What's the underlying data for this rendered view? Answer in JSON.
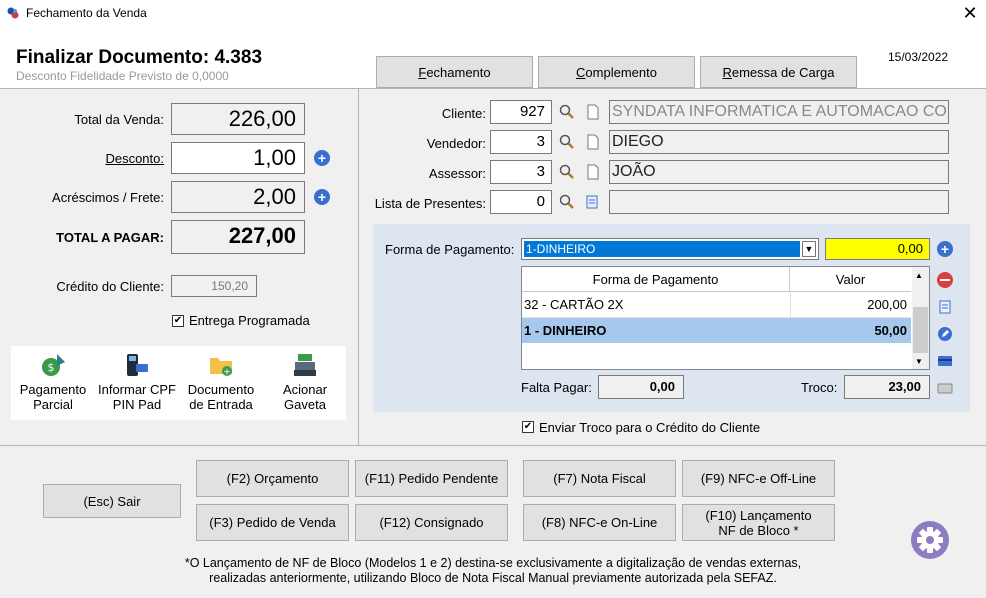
{
  "window": {
    "title": "Fechamento da Venda",
    "close_glyph": "✕"
  },
  "header": {
    "doc_title": "Finalizar Documento: 4.383",
    "doc_subtitle": "Desconto Fidelidade Previsto de 0,0000",
    "date": "15/03/2022",
    "tabs": [
      {
        "label": "Fechamento"
      },
      {
        "label": "Complemento"
      },
      {
        "label": "Remessa de Carga"
      }
    ]
  },
  "totals": {
    "total_label": "Total da Venda:",
    "total_value": "226,00",
    "discount_label": "Desconto:",
    "discount_value": "1,00",
    "surcharge_label": "Acréscimos / Frete:",
    "surcharge_value": "2,00",
    "to_pay_label": "TOTAL A PAGAR:",
    "to_pay_value": "227,00",
    "credit_label": "Crédito do Cliente:",
    "credit_value": "150,20",
    "scheduled_label": "Entrega Programada",
    "scheduled_checked": true
  },
  "tools": [
    {
      "label1": "Pagamento",
      "label2": "Parcial",
      "icon": "money-bag-icon"
    },
    {
      "label1": "Informar CPF",
      "label2": "PIN Pad",
      "icon": "pinpad-icon"
    },
    {
      "label1": "Documento",
      "label2": "de Entrada",
      "icon": "folder-add-icon"
    },
    {
      "label1": "Acionar",
      "label2": "Gaveta",
      "icon": "cash-register-icon"
    }
  ],
  "customer": {
    "cliente_label": "Cliente:",
    "cliente_code": "927",
    "cliente_name": "SYNDATA INFORMATICA E AUTOMACAO COM",
    "vendedor_label": "Vendedor:",
    "vendedor_code": "3",
    "vendedor_name": "DIEGO",
    "assessor_label": "Assessor:",
    "assessor_code": "3",
    "assessor_name": "JOÃO",
    "presentes_label": "Lista de Presentes:",
    "presentes_code": "0",
    "presentes_name": ""
  },
  "payment": {
    "method_label": "Forma de Pagamento:",
    "method_selected": "1-DINHEIRO",
    "method_value": "0,00",
    "grid_headers": {
      "method": "Forma de Pagamento",
      "value": "Valor"
    },
    "rows": [
      {
        "method": "32 - CARTÃO 2X",
        "value": "200,00",
        "selected": false
      },
      {
        "method": "1 - DINHEIRO",
        "value": "50,00",
        "selected": true
      }
    ],
    "falta_label": "Falta Pagar:",
    "falta_value": "0,00",
    "troco_label": "Troco:",
    "troco_value": "23,00",
    "send_change_label": "Enviar Troco para o Crédito do Cliente",
    "send_change_checked": true
  },
  "buttons": {
    "exit": "(Esc) Sair",
    "orcamento": "(F2) Orçamento",
    "pedido_pendente": "(F11) Pedido Pendente",
    "nota_fiscal": "(F7) Nota Fiscal",
    "nfce_offline": "(F9) NFC-e Off-Line",
    "pedido_venda": "(F3) Pedido de Venda",
    "consignado": "(F12) Consignado",
    "nfce_online": "(F8) NFC-e On-Line",
    "lancamento_line1": "(F10) Lançamento",
    "lancamento_line2": "NF de Bloco *"
  },
  "footnote": {
    "line1": "*O Lançamento de NF de Bloco (Modelos 1 e 2) destina-se exclusivamente a digitalização de vendas externas,",
    "line2": "realizadas anteriormente, utilizando Bloco de Nota Fiscal Manual previamente autorizada pela SEFAZ."
  },
  "colors": {
    "accent_blue": "#3b6fcf",
    "highlight_yellow": "#ffff00",
    "selected_row": "#a6c8ed",
    "settings_purple": "#8e7cc3"
  }
}
